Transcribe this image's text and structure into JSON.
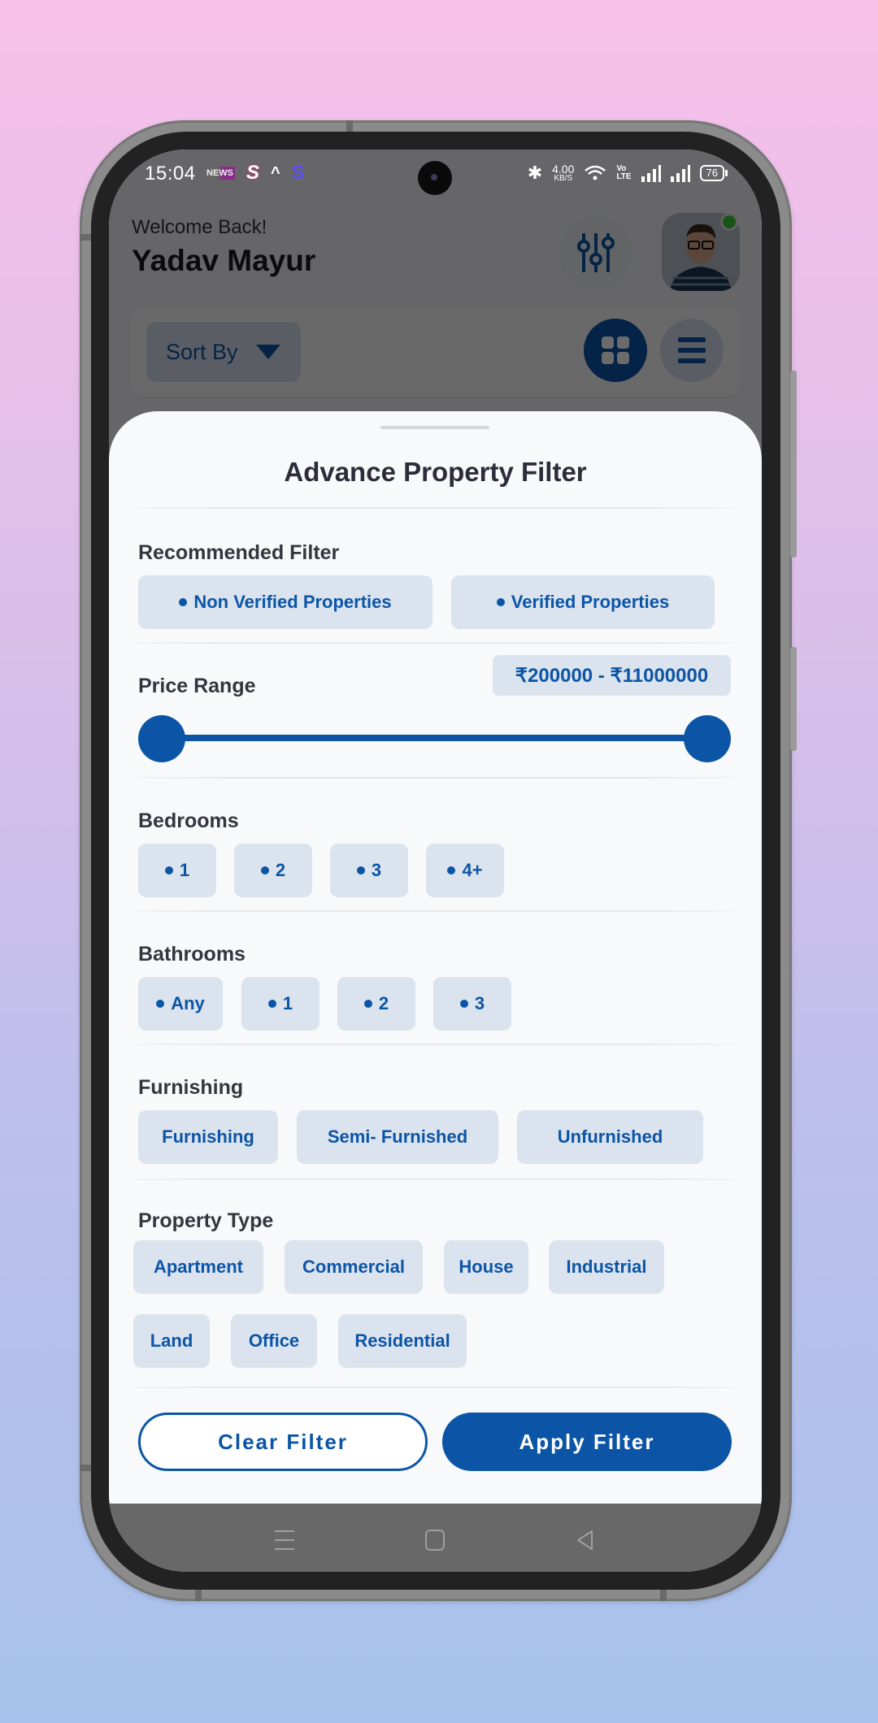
{
  "status_bar": {
    "time": "15:04",
    "notification_icons": [
      "news-app-icon",
      "s-app-red-icon",
      "chevron-up-icon",
      "s-app-blue-icon"
    ],
    "network_speed_value": "4.00",
    "network_speed_unit": "KB/S",
    "volte_label_top": "Vo",
    "volte_label_bottom": "LTE",
    "battery": "76"
  },
  "header": {
    "greeting": "Welcome Back!",
    "user_name": "Yadav Mayur"
  },
  "toolbar": {
    "sort_label": "Sort By"
  },
  "filter_sheet": {
    "title": "Advance Property Filter",
    "recommended": {
      "label": "Recommended Filter",
      "options": [
        "Non Verified Properties",
        "Verified Properties"
      ]
    },
    "price": {
      "label": "Price Range",
      "display": "₹200000 - ₹11000000",
      "min_value": 200000,
      "max_value": 11000000,
      "selected_min_fraction": 0.0,
      "selected_max_fraction": 1.0
    },
    "bedrooms": {
      "label": "Bedrooms",
      "options": [
        "1",
        "2",
        "3",
        "4+"
      ]
    },
    "bathrooms": {
      "label": "Bathrooms",
      "options": [
        "Any",
        "1",
        "2",
        "3"
      ]
    },
    "furnishing": {
      "label": "Furnishing",
      "options": [
        "Furnishing",
        "Semi- Furnished",
        "Unfurnished"
      ]
    },
    "property_type": {
      "label": "Property Type",
      "options": [
        "Apartment",
        "Commercial",
        "House",
        "Industrial",
        "Land",
        "Office",
        "Residential"
      ]
    },
    "clear_label": "Clear Filter",
    "apply_label": "Apply Filter"
  },
  "colors": {
    "primary": "#0c55a6",
    "chip_bg": "#dae3ee",
    "sheet_bg": "#f8f9fa",
    "online": "#3ec53e"
  }
}
